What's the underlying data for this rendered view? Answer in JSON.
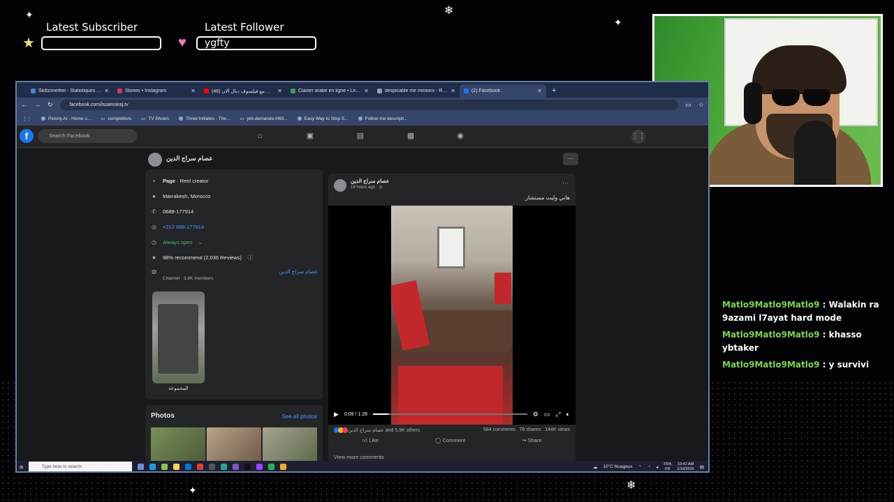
{
  "overlay": {
    "latest_subscriber_label": "Latest Subscriber",
    "latest_subscriber_value": "",
    "latest_follower_label": "Latest Follower",
    "latest_follower_value": "ygfty"
  },
  "chat": [
    {
      "user": "Matlo9Matlo9Matlo9",
      "sep": " : ",
      "text": "Walakin ra 9azami l7ayat hard mode"
    },
    {
      "user": "Matlo9Matlo9Matlo9",
      "sep": " : ",
      "text": "khasso ybtaker"
    },
    {
      "user": "Matlo9Matlo9Matlo9",
      "sep": " : ",
      "text": "y survivi"
    }
  ],
  "browser": {
    "tabs": [
      {
        "label": "Skillzone#iel - Statistiques de l'",
        "color": "#4a7fd4"
      },
      {
        "label": "Stories • Instagram",
        "color": "#d6336c"
      },
      {
        "label": "(46) اختلف مع فيلسوف ديال ألان",
        "color": "#ff0000"
      },
      {
        "label": "Clavier arabe en ligne • Lexilog",
        "color": "#3fa34d"
      },
      {
        "label": "despicable me minions - Reche",
        "color": "#9aa0a6"
      },
      {
        "label": "(2) Facebook",
        "color": "#1877f2",
        "active": true
      }
    ],
    "new_tab": "+",
    "url": "facebook.com/issamsiraj.tv",
    "bookmarks": [
      "Pictory.AI - Home o...",
      "competitors",
      "TV Shows",
      "Three Initiates - The...",
      "pré-demande-H69...",
      "Easy Way to Stop S...",
      "Follow me descripti..."
    ]
  },
  "facebook": {
    "logo": "f",
    "search_placeholder": "Search Facebook",
    "page_name": "عصام سراج الدين",
    "more": "···",
    "info": {
      "category_bold": "Page",
      "category_rest": " · Reel creator",
      "location": "Marrakesh, Morocco",
      "phone": "0688-177914",
      "whatsapp": "+212 688-177914",
      "hours": "Always open",
      "hours_chevron": "⌄",
      "recommend": "98% recommend (2,036 Reviews)",
      "channel_name": "عصام سراج الدين",
      "channel_sub": "Channel · 3.8K members",
      "story_label": "المجموعة"
    },
    "photos": {
      "title": "Photos",
      "see_all": "See all photos"
    },
    "post": {
      "author": "عصام سراج الدين",
      "time": "19 hours ago · ◎",
      "dots": "···",
      "text": "هاني وليت مستشار",
      "video_time": "0:09 / 1:28",
      "progress": 0.1,
      "reactions": "عصام سراج الدين and 5.9K others",
      "comments": "584 comments",
      "shares": "76 shares",
      "views": "144K views",
      "like": "Like",
      "comment": "Comment",
      "share": "Share",
      "view_more": "View more comments"
    }
  },
  "taskbar": {
    "search_placeholder": "Type here to search",
    "weather": "10°C  Nuageux",
    "lang_top": "FRA",
    "lang_bottom": "FR",
    "time": "10:42 AM",
    "date": "1/18/2026"
  }
}
